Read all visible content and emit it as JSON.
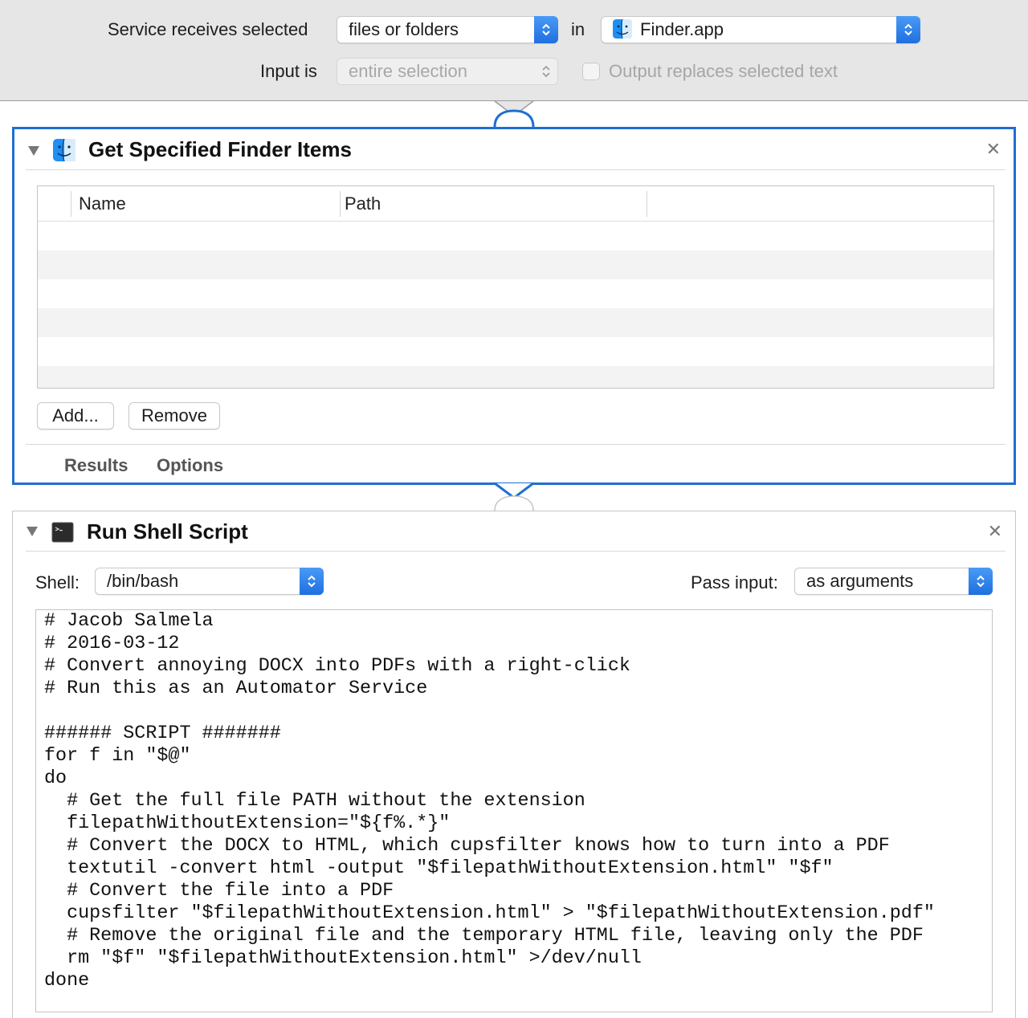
{
  "service": {
    "receives_label": "Service receives selected",
    "receives_value": "files or folders",
    "in_label": "in",
    "app_value": "Finder.app",
    "input_label": "Input is",
    "input_value": "entire selection",
    "output_replaces_label": "Output replaces selected text",
    "output_replaces_checked": false
  },
  "finder_action": {
    "title": "Get Specified Finder Items",
    "columns": [
      "Name",
      "Path"
    ],
    "rows": [],
    "add_button": "Add...",
    "remove_button": "Remove",
    "tabs": [
      "Results",
      "Options"
    ]
  },
  "shell_action": {
    "title": "Run Shell Script",
    "shell_label": "Shell:",
    "shell_value": "/bin/bash",
    "pass_input_label": "Pass input:",
    "pass_input_value": "as arguments",
    "script_lines": [
      "# Jacob Salmela",
      "# 2016-03-12",
      "# Convert annoying DOCX into PDFs with a right-click",
      "# Run this as an Automator Service",
      "",
      "###### SCRIPT #######",
      "for f in \"$@\"",
      "do",
      "  # Get the full file PATH without the extension",
      "  filepathWithoutExtension=\"${f%.*}\"",
      "  # Convert the DOCX to HTML, which cupsfilter knows how to turn into a PDF",
      "  textutil -convert html -output \"$filepathWithoutExtension.html\" \"$f\"",
      "  # Convert the file into a PDF",
      "  cupsfilter \"$filepathWithoutExtension.html\" > \"$filepathWithoutExtension.pdf\"",
      "  # Remove the original file and the temporary HTML file, leaving only the PDF",
      "  rm \"$f\" \"$filepathWithoutExtension.html\" >/dev/null",
      "done"
    ]
  },
  "colors": {
    "selection_blue": "#1f6fd1",
    "popup_arrow_blue": "#2a7ff0",
    "header_gray": "#e6e6e6"
  },
  "icons": {
    "finder": "finder-icon",
    "terminal": "terminal-icon",
    "close": "close-icon",
    "disclosure": "disclosure-triangle-icon",
    "popup_arrows": "updown-chevron-icon"
  }
}
